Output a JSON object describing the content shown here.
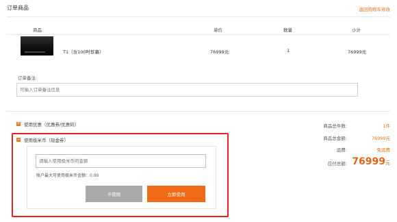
{
  "header": {
    "title": "订单商品",
    "back_link": "返回购物车修改"
  },
  "table": {
    "columns": [
      "商品",
      "单价",
      "数量",
      "小计"
    ],
    "rows": [
      {
        "name": "T1（含100吋软幕）",
        "price": "76999元",
        "qty": "1",
        "subtotal": "76999元"
      }
    ]
  },
  "remark": {
    "label": "订单备注:",
    "placeholder": "可输入订单备注信息"
  },
  "options": {
    "coupon": {
      "icon": "plus-box-icon",
      "label": "使用优惠（优惠券/优惠码）"
    },
    "mibi": {
      "icon": "minus-box-icon",
      "label": "使用极米币（现金券）"
    }
  },
  "mibi_panel": {
    "placeholder": "请输入使用极米币的金额",
    "max_note": "账户最大可使用极米币金额：0.00",
    "btn_cancel": "不使用",
    "btn_apply": "立即使用"
  },
  "summary": {
    "items_label": "商品总件数:",
    "items_value": "1件",
    "amount_label": "商品总金额:",
    "amount_value": "76999元",
    "shipping_label": "运费:",
    "shipping_value": "免运费",
    "total_label": "应付总额:",
    "total_value": "76999",
    "total_unit": "元"
  },
  "colors": {
    "accent": "#e0721a",
    "highlight_frame": "#e8231c",
    "button_gray": "#a8a8a8",
    "button_orange": "#ee6a17"
  }
}
